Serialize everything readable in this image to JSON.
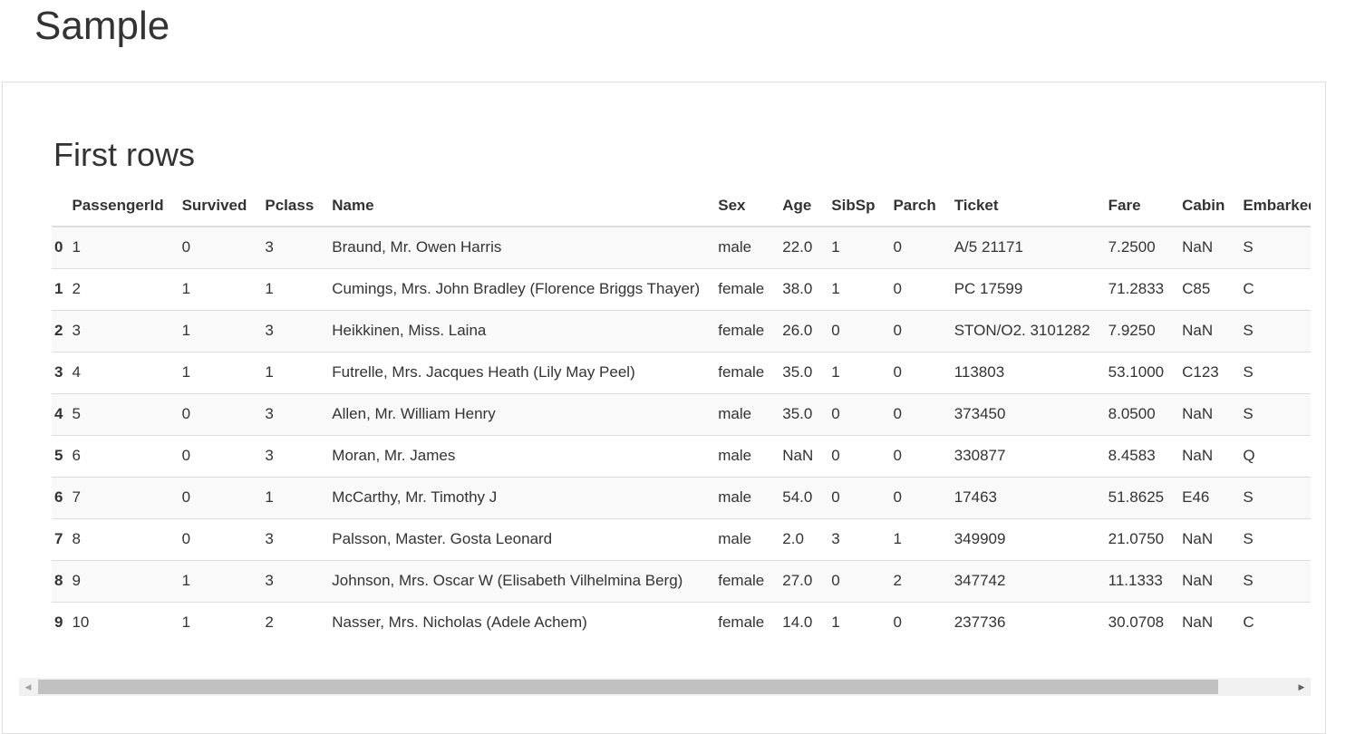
{
  "page": {
    "title": "Sample"
  },
  "section": {
    "title": "First rows"
  },
  "table": {
    "columns": [
      "",
      "PassengerId",
      "Survived",
      "Pclass",
      "Name",
      "Sex",
      "Age",
      "SibSp",
      "Parch",
      "Ticket",
      "Fare",
      "Cabin",
      "Embarked"
    ],
    "rows": [
      [
        "0",
        "1",
        "0",
        "3",
        "Braund, Mr. Owen Harris",
        "male",
        "22.0",
        "1",
        "0",
        "A/5 21171",
        "7.2500",
        "NaN",
        "S"
      ],
      [
        "1",
        "2",
        "1",
        "1",
        "Cumings, Mrs. John Bradley (Florence Briggs Thayer)",
        "female",
        "38.0",
        "1",
        "0",
        "PC 17599",
        "71.2833",
        "C85",
        "C"
      ],
      [
        "2",
        "3",
        "1",
        "3",
        "Heikkinen, Miss. Laina",
        "female",
        "26.0",
        "0",
        "0",
        "STON/O2. 3101282",
        "7.9250",
        "NaN",
        "S"
      ],
      [
        "3",
        "4",
        "1",
        "1",
        "Futrelle, Mrs. Jacques Heath (Lily May Peel)",
        "female",
        "35.0",
        "1",
        "0",
        "113803",
        "53.1000",
        "C123",
        "S"
      ],
      [
        "4",
        "5",
        "0",
        "3",
        "Allen, Mr. William Henry",
        "male",
        "35.0",
        "0",
        "0",
        "373450",
        "8.0500",
        "NaN",
        "S"
      ],
      [
        "5",
        "6",
        "0",
        "3",
        "Moran, Mr. James",
        "male",
        "NaN",
        "0",
        "0",
        "330877",
        "8.4583",
        "NaN",
        "Q"
      ],
      [
        "6",
        "7",
        "0",
        "1",
        "McCarthy, Mr. Timothy J",
        "male",
        "54.0",
        "0",
        "0",
        "17463",
        "51.8625",
        "E46",
        "S"
      ],
      [
        "7",
        "8",
        "0",
        "3",
        "Palsson, Master. Gosta Leonard",
        "male",
        "2.0",
        "3",
        "1",
        "349909",
        "21.0750",
        "NaN",
        "S"
      ],
      [
        "8",
        "9",
        "1",
        "3",
        "Johnson, Mrs. Oscar W (Elisabeth Vilhelmina Berg)",
        "female",
        "27.0",
        "0",
        "2",
        "347742",
        "11.1333",
        "NaN",
        "S"
      ],
      [
        "9",
        "10",
        "1",
        "2",
        "Nasser, Mrs. Nicholas (Adele Achem)",
        "female",
        "14.0",
        "1",
        "0",
        "237736",
        "30.0708",
        "NaN",
        "C"
      ]
    ]
  },
  "scrollbar": {
    "left_arrow_icon": "triangle-left-icon",
    "right_arrow_icon": "triangle-right-icon",
    "position_fraction": 0.0
  }
}
